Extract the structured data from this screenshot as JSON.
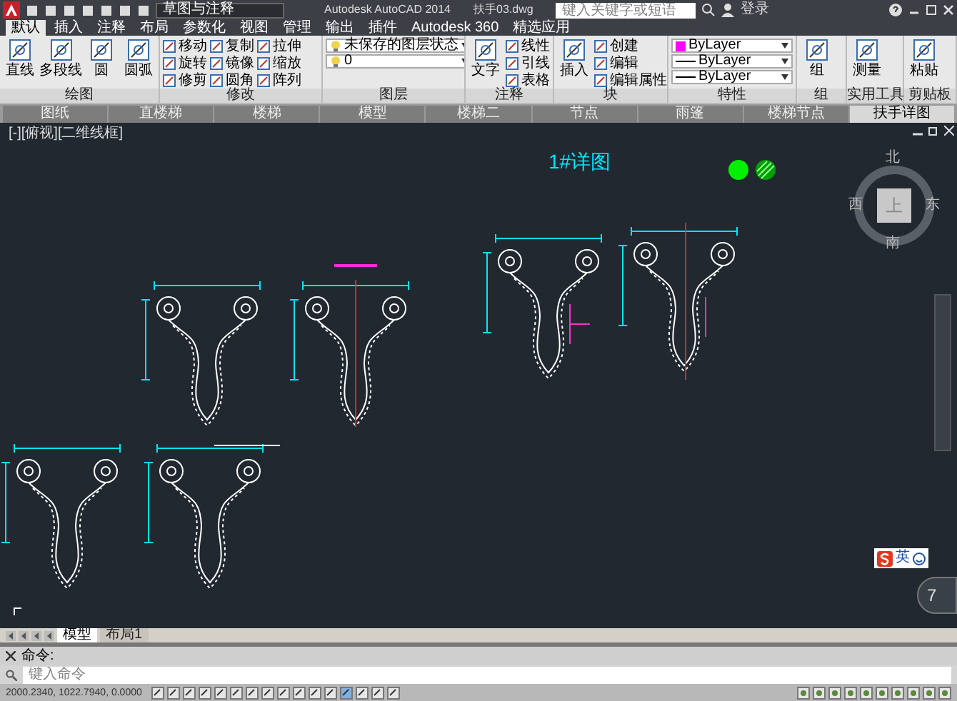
{
  "title_bar": {
    "workspace": "草图与注释",
    "app_title": "Autodesk AutoCAD 2014",
    "file_name": "扶手03.dwg",
    "search_placeholder": "键入关键字或短语",
    "sign_in": "登录"
  },
  "ribbon_tabs": [
    {
      "label": "默认",
      "selected": true
    },
    {
      "label": "插入",
      "selected": false
    },
    {
      "label": "注释",
      "selected": false
    },
    {
      "label": "布局",
      "selected": false
    },
    {
      "label": "参数化",
      "selected": false
    },
    {
      "label": "视图",
      "selected": false
    },
    {
      "label": "管理",
      "selected": false
    },
    {
      "label": "输出",
      "selected": false
    },
    {
      "label": "插件",
      "selected": false
    },
    {
      "label": "Autodesk 360",
      "selected": false
    },
    {
      "label": "精选应用",
      "selected": false
    }
  ],
  "ribbon_panels": [
    {
      "title": "绘图",
      "tools": [
        {
          "label": "直线",
          "kind": "large"
        },
        {
          "label": "多段线",
          "kind": "large"
        },
        {
          "label": "圆",
          "kind": "large"
        },
        {
          "label": "圆弧",
          "kind": "large"
        }
      ]
    },
    {
      "title": "修改",
      "tools": [
        {
          "label": "移动",
          "kind": "small"
        },
        {
          "label": "旋转",
          "kind": "small"
        },
        {
          "label": "修剪",
          "kind": "small"
        },
        {
          "label": "复制",
          "kind": "small"
        },
        {
          "label": "镜像",
          "kind": "small"
        },
        {
          "label": "圆角",
          "kind": "small"
        },
        {
          "label": "拉伸",
          "kind": "small"
        },
        {
          "label": "缩放",
          "kind": "small"
        },
        {
          "label": "阵列",
          "kind": "small"
        }
      ]
    },
    {
      "title": "图层",
      "tools": [
        {
          "label": "未保存的图层状态",
          "kind": "dropdown"
        },
        {
          "label": "0",
          "kind": "dropdown"
        }
      ]
    },
    {
      "title": "注释",
      "tools": [
        {
          "label": "文字",
          "kind": "large"
        },
        {
          "label": "线性",
          "kind": "small"
        },
        {
          "label": "引线",
          "kind": "small"
        },
        {
          "label": "表格",
          "kind": "small"
        }
      ]
    },
    {
      "title": "块",
      "tools": [
        {
          "label": "插入",
          "kind": "large"
        },
        {
          "label": "创建",
          "kind": "small"
        },
        {
          "label": "编辑",
          "kind": "small"
        },
        {
          "label": "编辑属性",
          "kind": "small"
        }
      ]
    },
    {
      "title": "特性",
      "tools": [
        {
          "label": "ByLayer",
          "kind": "dropdown"
        },
        {
          "label": "ByLayer",
          "kind": "dropdown"
        },
        {
          "label": "ByLayer",
          "kind": "dropdown"
        }
      ]
    },
    {
      "title": "组",
      "tools": [
        {
          "label": "组",
          "kind": "large"
        }
      ]
    },
    {
      "title": "实用工具",
      "tools": [
        {
          "label": "测量",
          "kind": "large"
        }
      ]
    },
    {
      "title": "剪贴板",
      "tools": [
        {
          "label": "粘贴",
          "kind": "large"
        }
      ]
    }
  ],
  "document_tabs": [
    {
      "label": "图纸",
      "selected": false
    },
    {
      "label": "直楼梯",
      "selected": false
    },
    {
      "label": "楼梯",
      "selected": false
    },
    {
      "label": "模型",
      "selected": false
    },
    {
      "label": "楼梯二",
      "selected": false
    },
    {
      "label": "节点",
      "selected": false
    },
    {
      "label": "雨篷",
      "selected": false
    },
    {
      "label": "楼梯节点",
      "selected": false
    },
    {
      "label": "扶手详图",
      "selected": true
    }
  ],
  "viewport": {
    "label": "[-][俯视][二维线框]",
    "heading": "1#详图",
    "viewcube": {
      "north": "北",
      "south": "南",
      "east": "东",
      "west": "西",
      "face": "上"
    }
  },
  "ime_bar": {
    "mode": "英"
  },
  "zoom_badge": "7",
  "layout_tabs": [
    {
      "label": "模型",
      "selected": true
    },
    {
      "label": "布局1",
      "selected": false
    }
  ],
  "command_line": {
    "history": "命令:",
    "placeholder": "键入命令"
  },
  "status_bar": {
    "coordinates": "2000.2340, 1022.7940, 0.0000"
  }
}
